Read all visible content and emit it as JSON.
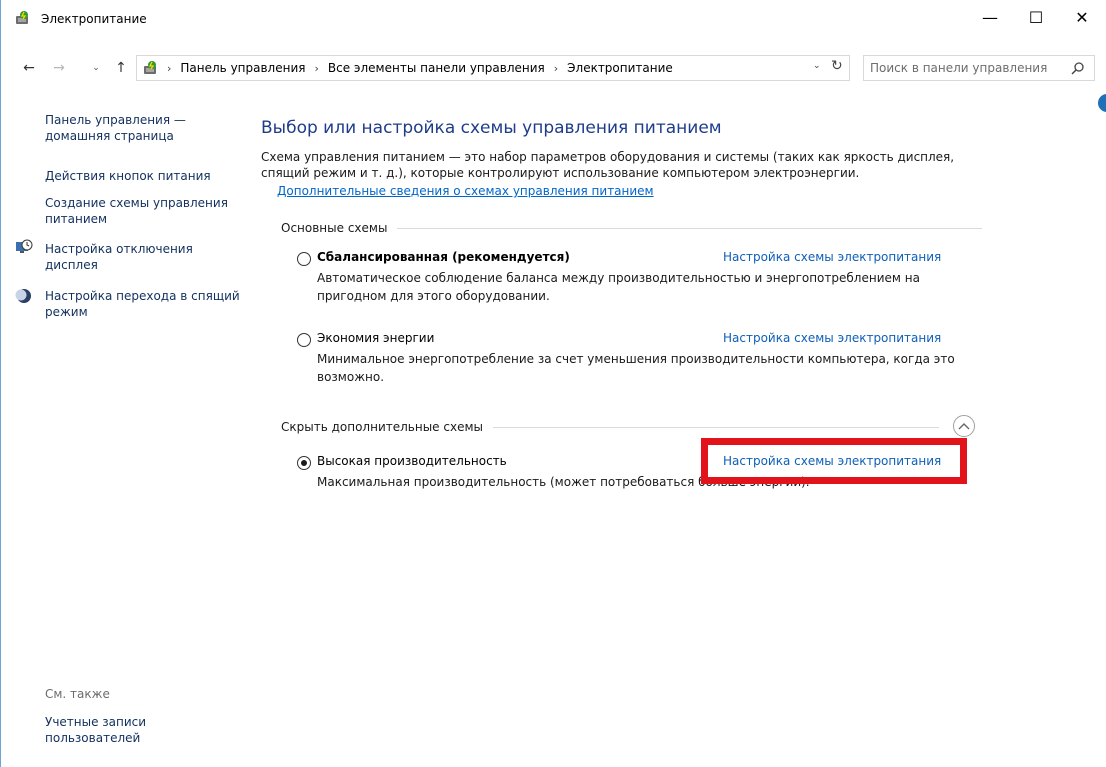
{
  "window": {
    "title": "Электропитание",
    "minimize_glyph": "—",
    "maximize_glyph": "☐",
    "close_glyph": "✕"
  },
  "nav": {
    "back_glyph": "←",
    "forward_glyph": "→",
    "recent_glyph": "⌄",
    "up_glyph": "↑",
    "breadcrumbs": [
      "Панель управления",
      "Все элементы панели управления",
      "Электропитание"
    ],
    "crumb_separator": "›",
    "dropdown_glyph": "⌄",
    "refresh_glyph": "↻",
    "search_placeholder": "Поиск в панели управления"
  },
  "sidebar": {
    "home_link": "Панель управления — домашняя страница",
    "items": [
      {
        "label": "Действия кнопок питания",
        "icon": ""
      },
      {
        "label": "Создание схемы управления питанием",
        "icon": ""
      },
      {
        "label": "Настройка отключения дисплея",
        "icon": "monitor-clock-icon"
      },
      {
        "label": "Настройка перехода в спящий режим",
        "icon": "moon-icon"
      }
    ],
    "see_also": "См. также",
    "see_also_items": [
      "Учетные записи пользователей"
    ]
  },
  "main": {
    "title": "Выбор или настройка схемы управления питанием",
    "description": "Схема управления питанием — это набор параметров оборудования и системы (таких как яркость дисплея, спящий режим и т. д.), которые контролируют использование компьютером электроэнергии.",
    "more_info_link": "Дополнительные сведения о схемах управления питанием",
    "primary_group": "Основные схемы",
    "hidden_group": "Скрыть дополнительные схемы",
    "schemes": [
      {
        "name": "Сбалансированная (рекомендуется)",
        "desc": "Автоматическое соблюдение баланса между производительностью и энергопотреблением на пригодном для этого оборудовании.",
        "link": "Настройка схемы электропитания",
        "selected": false
      },
      {
        "name": "Экономия энергии",
        "desc": "Минимальное энергопотребление за счет уменьшения производительности компьютера, когда это возможно.",
        "link": "Настройка схемы электропитания",
        "selected": false
      },
      {
        "name": "Высокая производительность",
        "desc": "Максимальная производительность (может потребоваться больше энергии).",
        "link": "Настройка схемы электропитания",
        "selected": true
      }
    ]
  },
  "colors": {
    "title_blue": "#1e3c8c",
    "link_blue": "#0e5fb8",
    "highlight_red": "#e3131b"
  }
}
